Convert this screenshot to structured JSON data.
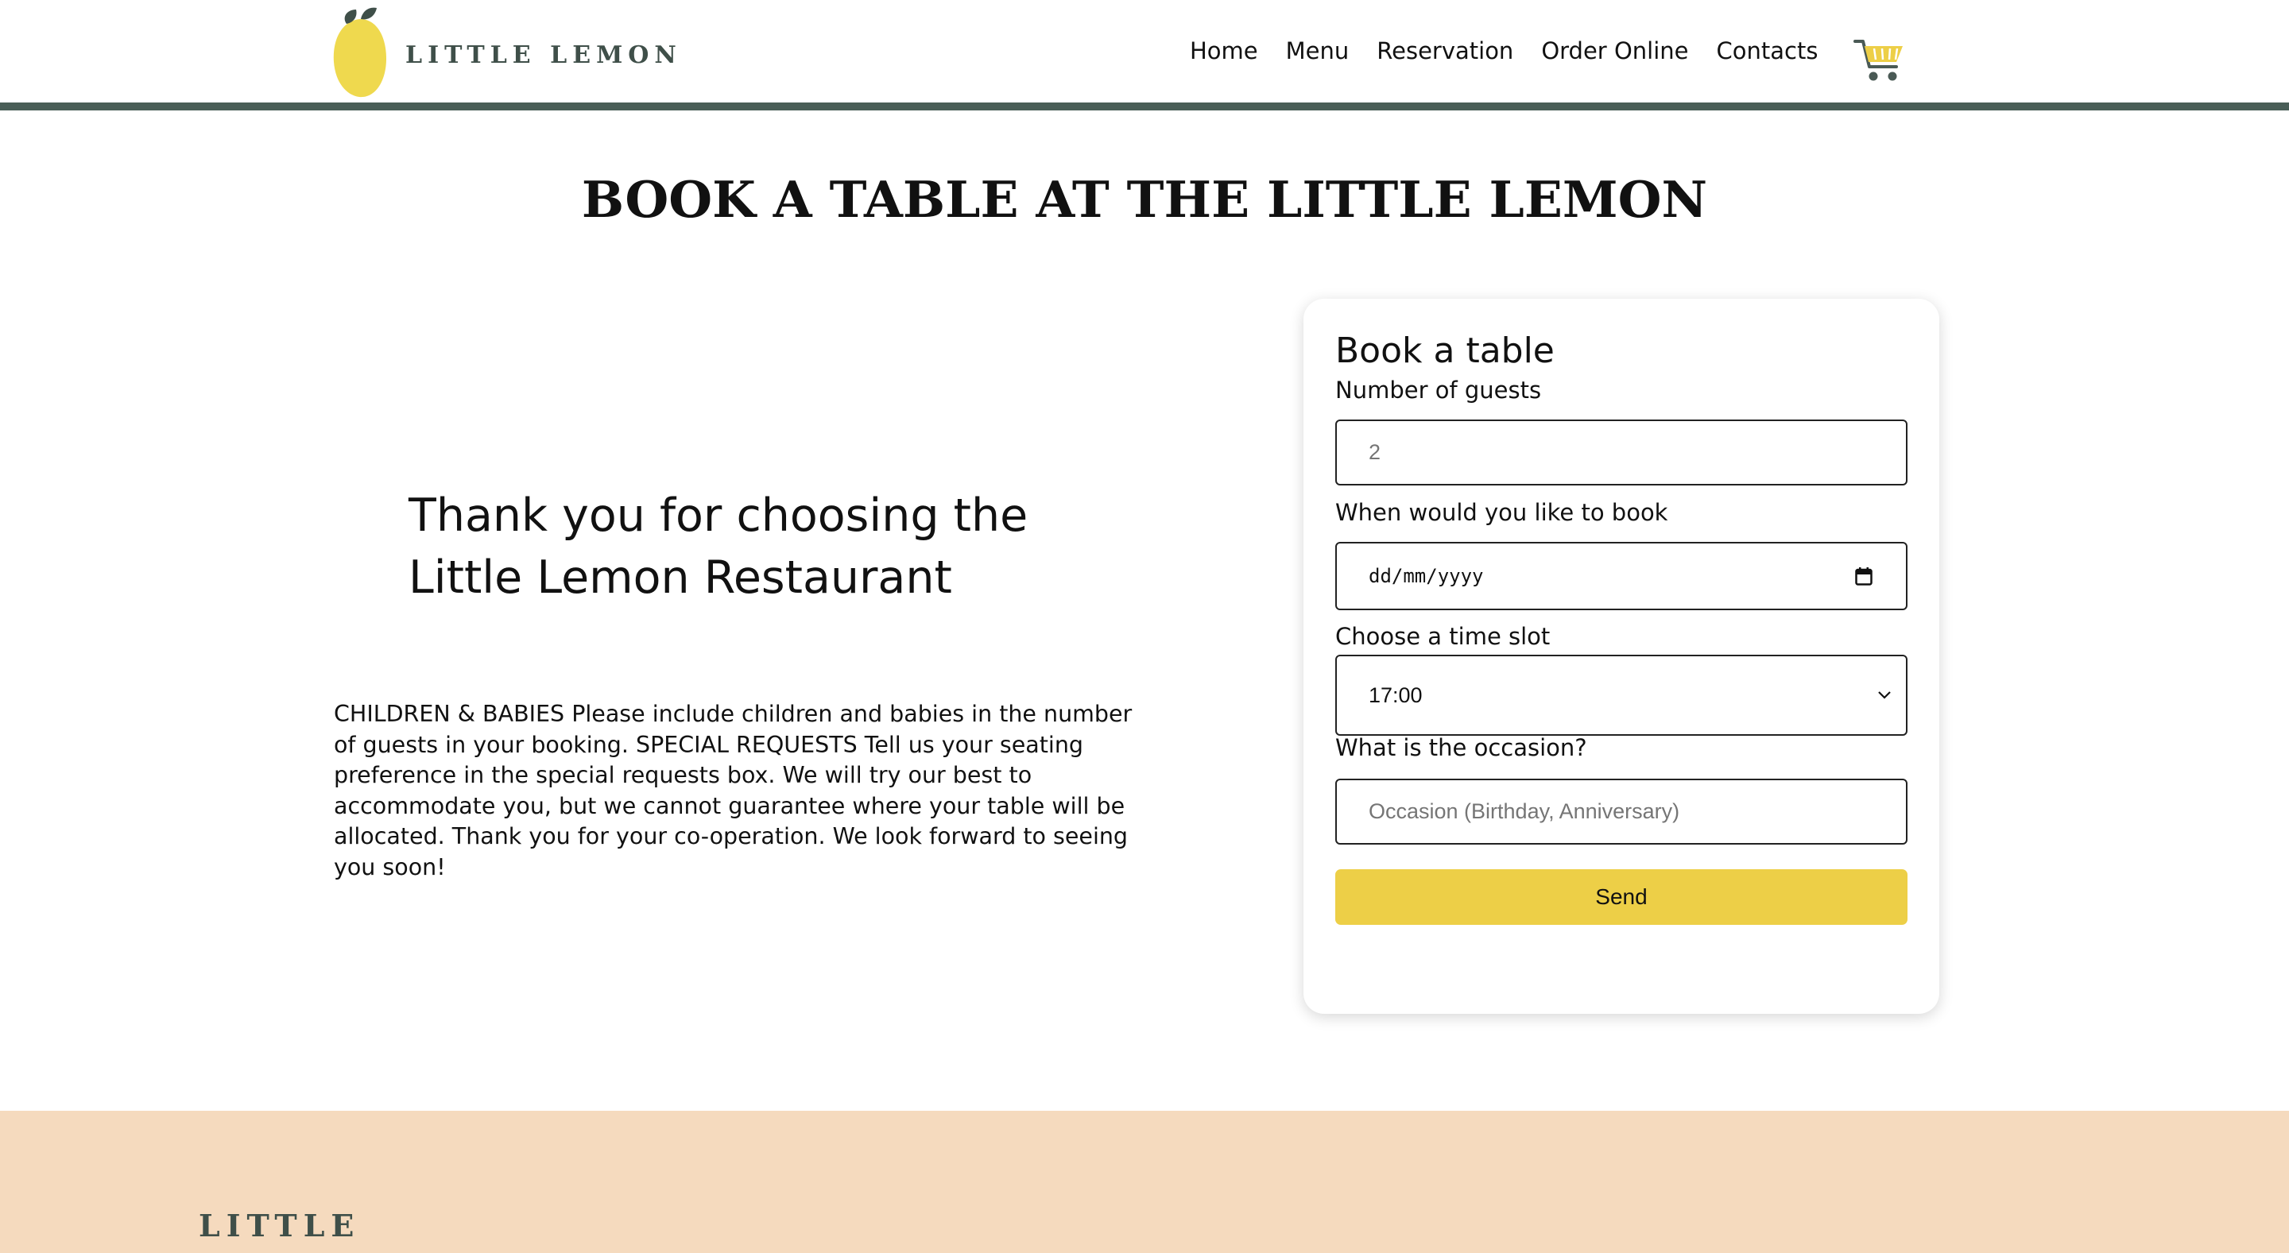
{
  "header": {
    "brand": "LITTLE LEMON",
    "nav": [
      "Home",
      "Menu",
      "Reservation",
      "Order Online",
      "Contacts"
    ],
    "cart_icon": "cart-icon"
  },
  "main": {
    "title": "BOOK A TABLE AT THE LITTLE LEMON",
    "thanks": "Thank you for choosing the Little Lemon Restaurant",
    "info": "CHILDREN & BABIES Please include children and babies in the number of guests in your booking. SPECIAL REQUESTS Tell us your seating preference in the special requests box. We will try our best to accommodate you, but we cannot guarantee where your table will be allocated. Thank you for your co-operation. We look forward to seeing you soon!"
  },
  "form": {
    "title": "Book a table",
    "guests_label": "Number of guests",
    "guests_placeholder": "2",
    "date_label": "When would you like to book",
    "date_placeholder": "dd/mm/yyyy",
    "time_label": "Choose a time slot",
    "time_value": "17:00",
    "occasion_label": "What is the occasion?",
    "occasion_placeholder": "Occasion (Birthday, Anniversary)",
    "send_label": "Send"
  },
  "footer": {
    "brand": "LITTLE"
  },
  "colors": {
    "accent_yellow": "#edcf47",
    "brand_green": "#495e57",
    "footer_bg": "#f5dabe"
  }
}
